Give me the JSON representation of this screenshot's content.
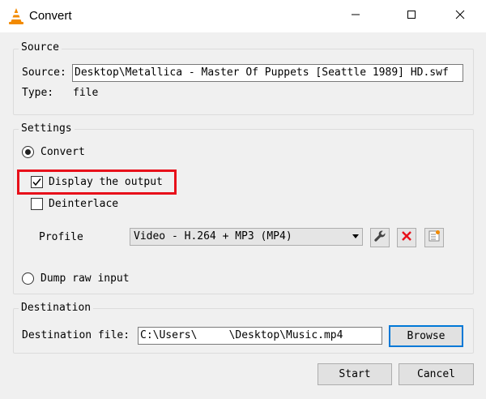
{
  "window": {
    "title": "Convert",
    "app_icon": "vlc-cone-icon",
    "minimize_icon": "minimize-icon",
    "maximize_icon": "maximize-icon",
    "close_icon": "close-icon"
  },
  "source": {
    "group_label": "Source",
    "source_label": "Source:",
    "source_value": "Desktop\\Metallica - Master Of Puppets [Seattle 1989] HD.swf",
    "type_label": "Type:",
    "type_value": "file"
  },
  "settings": {
    "group_label": "Settings",
    "convert_label": "Convert",
    "convert_selected": true,
    "display_output_label": "Display the output",
    "display_output_checked": true,
    "deinterlace_label": "Deinterlace",
    "deinterlace_checked": false,
    "profile_label": "Profile",
    "profile_value": "Video - H.264 + MP3 (MP4)",
    "profile_tools": [
      "wrench-icon",
      "delete-icon",
      "new-profile-icon"
    ],
    "dump_raw_label": "Dump raw input",
    "dump_raw_selected": false
  },
  "destination": {
    "group_label": "Destination",
    "file_label": "Destination file:",
    "file_value": "C:\\Users\\     \\Desktop\\Music.mp4",
    "browse_label": "Browse"
  },
  "buttons": {
    "start_label": "Start",
    "cancel_label": "Cancel"
  },
  "colors": {
    "highlight": "#e8101a",
    "default_button_border": "#0078d7",
    "vlc_orange": "#f28a00"
  }
}
